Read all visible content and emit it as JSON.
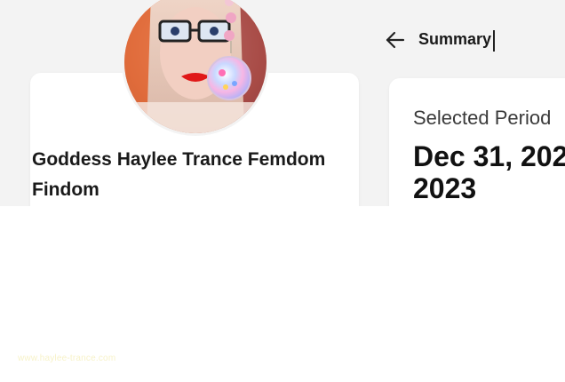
{
  "header": {
    "back_icon": "arrow-left-icon",
    "title": "Summary"
  },
  "profile": {
    "name": "Goddess Haylee Trance Femdom Findom",
    "avatar_icon": "profile-photo"
  },
  "period": {
    "label": "Selected Period",
    "value": "Dec 31, 202\n2023"
  },
  "watermark": {
    "text": "www.haylee-trance.com"
  },
  "colors": {
    "background": "#f3f3f3",
    "card": "#ffffff",
    "text": "#111111"
  }
}
